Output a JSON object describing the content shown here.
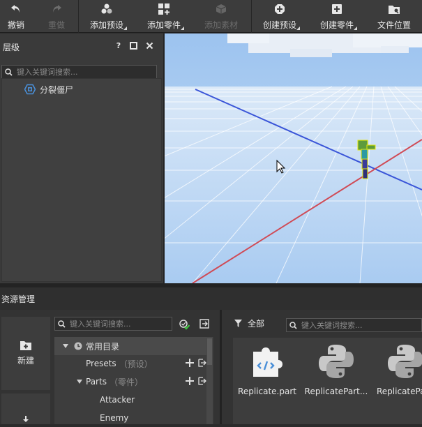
{
  "toolbar": {
    "undo": "撤销",
    "redo": "重做",
    "add_preset": "添加预设",
    "add_part": "添加零件",
    "add_material": "添加素材",
    "create_preset": "创建预设",
    "create_part": "创建零件",
    "file_location": "文件位置"
  },
  "hierarchy": {
    "title": "层级",
    "help": "?",
    "search_placeholder": "键入关键词搜索...",
    "items": [
      {
        "label": "分裂僵尸"
      }
    ]
  },
  "resources": {
    "title": "资源管理",
    "new_label": "新建",
    "search_placeholder": "键入关键词搜索...",
    "tree": {
      "root": "常用目录",
      "presets": "Presets",
      "presets_sub": "（预设）",
      "parts": "Parts",
      "parts_sub": "（零件）",
      "children": [
        "Attacker",
        "Enemy"
      ]
    },
    "filter_label": "全部",
    "grid_search_placeholder": "键入关键词搜索...",
    "tiles": [
      {
        "name": "Replicate.part",
        "icon": "puzzle-code-icon"
      },
      {
        "name": "ReplicatePart...",
        "icon": "python-icon"
      },
      {
        "name": "ReplicatePa",
        "icon": "python-icon"
      }
    ]
  },
  "colors": {
    "accent_blue": "#4a8fd8",
    "check_green": "#3fc43f",
    "sky": "#b9d4f3"
  }
}
